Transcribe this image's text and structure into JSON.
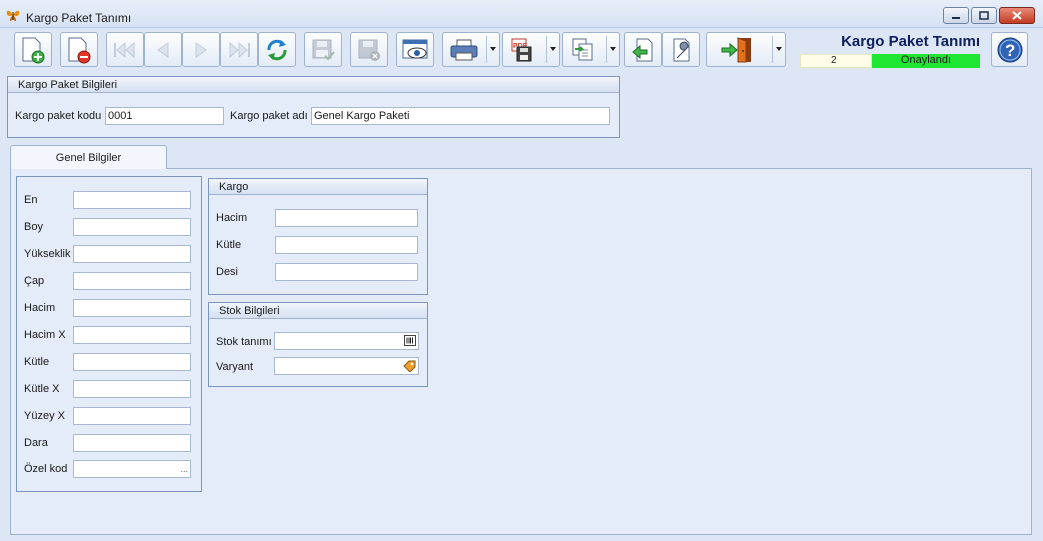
{
  "window": {
    "title": "Kargo Paket Tanımı",
    "app_icon": "butterfly-icon",
    "controls": [
      "minimize-icon",
      "restore-icon",
      "close-icon"
    ]
  },
  "toolbar": {
    "buttons": [
      {
        "name": "new-document-icon",
        "enabled": true
      },
      {
        "name": "delete-document-icon",
        "enabled": true
      },
      {
        "name": "first-record-icon",
        "enabled": false
      },
      {
        "name": "previous-record-icon",
        "enabled": false
      },
      {
        "name": "next-record-icon",
        "enabled": false
      },
      {
        "name": "last-record-icon",
        "enabled": false
      },
      {
        "name": "refresh-icon",
        "enabled": true
      },
      {
        "name": "save-icon",
        "enabled": false
      },
      {
        "name": "save-cancel-icon",
        "enabled": false
      },
      {
        "name": "preview-icon",
        "enabled": true
      },
      {
        "name": "print-icon",
        "enabled": true,
        "dropdown": true
      },
      {
        "name": "pdf-export-icon",
        "enabled": true,
        "dropdown": true
      },
      {
        "name": "copy-document-icon",
        "enabled": true,
        "dropdown": true
      },
      {
        "name": "import-icon",
        "enabled": true
      },
      {
        "name": "tools-icon",
        "enabled": true
      },
      {
        "name": "exit-icon",
        "enabled": true,
        "dropdown": true
      }
    ]
  },
  "header": {
    "form_title": "Kargo Paket Tanımı",
    "record_number": "2",
    "status": "Onaylandı",
    "status_color": "#1ee632"
  },
  "package_info": {
    "title": "Kargo Paket Bilgileri",
    "code_label": "Kargo paket kodu",
    "code_value": "0001",
    "name_label": "Kargo paket adı",
    "name_value": "Genel Kargo Paketi"
  },
  "tabs": [
    {
      "label": "Genel Bilgiler",
      "active": true
    }
  ],
  "general_fields": [
    {
      "label": "En",
      "value": ""
    },
    {
      "label": "Boy",
      "value": ""
    },
    {
      "label": "Yükseklik",
      "value": ""
    },
    {
      "label": "Çap",
      "value": ""
    },
    {
      "label": "Hacim",
      "value": ""
    },
    {
      "label": "Hacim X",
      "value": ""
    },
    {
      "label": "Kütle",
      "value": ""
    },
    {
      "label": "Kütle X",
      "value": ""
    },
    {
      "label": "Yüzey X",
      "value": ""
    },
    {
      "label": "Dara",
      "value": ""
    },
    {
      "label": "Özel kod",
      "value": "",
      "has_ellipsis": true,
      "ellipsis": "..."
    }
  ],
  "kargo_group": {
    "title": "Kargo",
    "fields": [
      {
        "label": "Hacim",
        "value": ""
      },
      {
        "label": "Kütle",
        "value": ""
      },
      {
        "label": "Desi",
        "value": ""
      }
    ]
  },
  "stock_group": {
    "title": "Stok Bilgileri",
    "fields": [
      {
        "label": "Stok tanımı",
        "value": "",
        "icon": "barcode-icon"
      },
      {
        "label": "Varyant",
        "value": "",
        "icon": "tag-icon"
      }
    ]
  }
}
